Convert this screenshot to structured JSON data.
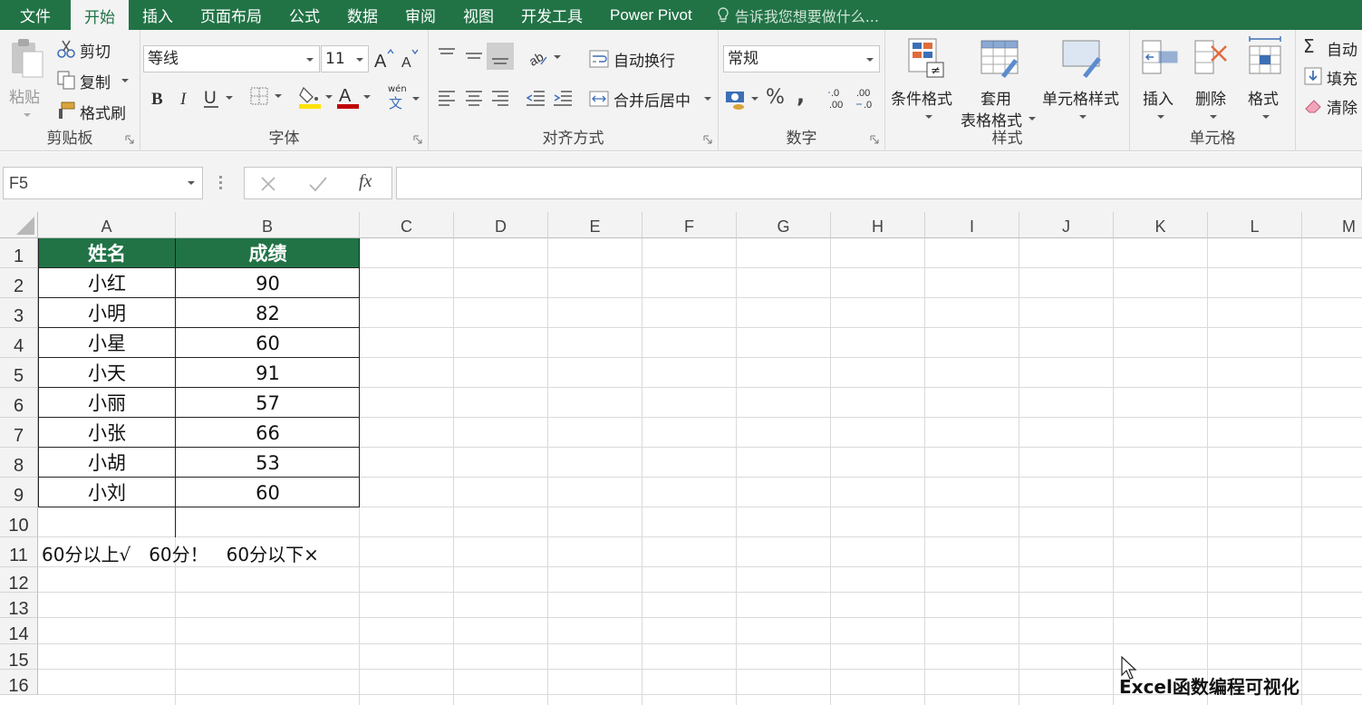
{
  "menu": {
    "file": "文件",
    "tabs": [
      "开始",
      "插入",
      "页面布局",
      "公式",
      "数据",
      "审阅",
      "视图",
      "开发工具",
      "Power Pivot"
    ],
    "active_tab": "开始",
    "tell_me": "告诉我您想要做什么..."
  },
  "ribbon": {
    "clipboard": {
      "label": "剪贴板",
      "paste": "粘贴",
      "cut": "剪切",
      "copy": "复制",
      "format_painter": "格式刷"
    },
    "font": {
      "label": "字体",
      "name": "等线",
      "size": "11",
      "wen": "wén",
      "wen2": "文"
    },
    "alignment": {
      "label": "对齐方式",
      "wrap": "自动换行",
      "merge": "合并后居中"
    },
    "number": {
      "label": "数字",
      "format": "常规",
      "percent": "%",
      "comma": ",",
      "inc_dec": "←.0\n.00",
      "dec_dec": ".00\n→.0"
    },
    "styles": {
      "label": "样式",
      "conditional": "条件格式",
      "table_format_1": "套用",
      "table_format_2": "表格格式",
      "cell_styles": "单元格样式"
    },
    "cells": {
      "label": "单元格",
      "insert": "插入",
      "delete": "删除",
      "format": "格式"
    },
    "editing": {
      "autosum": "自动",
      "fill": "填充",
      "clear": "清除"
    }
  },
  "formula_bar": {
    "name_box": "F5",
    "fx": "fx",
    "value": ""
  },
  "columns": [
    "A",
    "B",
    "C",
    "D",
    "E",
    "F",
    "G",
    "H",
    "I",
    "J",
    "K",
    "L",
    "M"
  ],
  "rows": [
    "1",
    "2",
    "3",
    "4",
    "5",
    "6",
    "7",
    "8",
    "9",
    "10",
    "11",
    "12",
    "13",
    "14",
    "15",
    "16"
  ],
  "table": {
    "headers": [
      "姓名",
      "成绩"
    ],
    "rows": [
      [
        "小红",
        "90"
      ],
      [
        "小明",
        "82"
      ],
      [
        "小星",
        "60"
      ],
      [
        "小天",
        "91"
      ],
      [
        "小丽",
        "57"
      ],
      [
        "小张",
        "66"
      ],
      [
        "小胡",
        "53"
      ],
      [
        "小刘",
        "60"
      ]
    ]
  },
  "note": "60分以上√　60分！　60分以下×",
  "watermark": "Excel函数编程可视化",
  "colors": {
    "brand": "#217346",
    "header_fill": "#217346"
  }
}
